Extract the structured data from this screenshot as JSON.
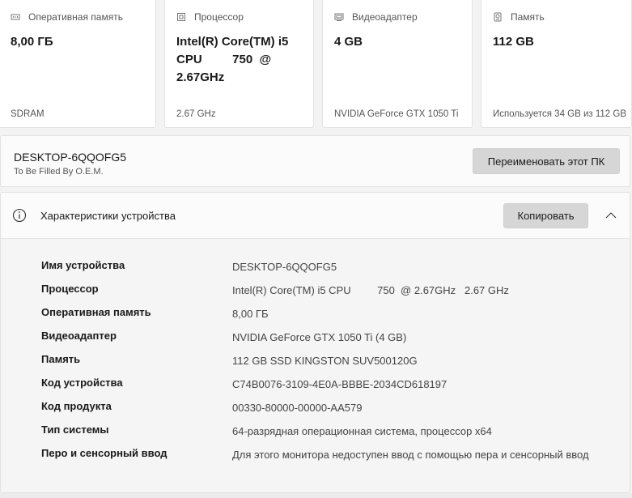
{
  "cards": [
    {
      "caption": "Оперативная память",
      "value": "8,00 ГБ",
      "sub": "SDRAM",
      "icon": "ram-icon"
    },
    {
      "caption": "Процессор",
      "value": "Intel(R) Core(TM) i5\nCPU         750  @\n2.67GHz",
      "sub": "2.67 GHz",
      "icon": "cpu-icon"
    },
    {
      "caption": "Видеоадаптер",
      "value": "4 GB",
      "sub": "NVIDIA GeForce GTX 1050 Ti",
      "icon": "gpu-icon"
    },
    {
      "caption": "Память",
      "value": "112 GB",
      "sub": "Используется 34 GB из 112 GB",
      "icon": "storage-icon"
    }
  ],
  "device": {
    "name": "DESKTOP-6QQOFG5",
    "oem": "To Be Filled By O.E.M.",
    "rename_label": "Переименовать этот ПК"
  },
  "specs": {
    "title": "Характеристики устройства",
    "copy_label": "Копировать",
    "rows": [
      {
        "key": "Имя устройства",
        "value": "DESKTOP-6QQOFG5"
      },
      {
        "key": "Процессор",
        "value": "Intel(R) Core(TM) i5 CPU         750  @ 2.67GHz   2.67 GHz"
      },
      {
        "key": "Оперативная память",
        "value": "8,00 ГБ"
      },
      {
        "key": "Видеоадаптер",
        "value": "NVIDIA GeForce GTX 1050 Ti (4 GB)"
      },
      {
        "key": "Память",
        "value": "112 GB SSD KINGSTON SUV500120G"
      },
      {
        "key": "Код устройства",
        "value": "C74B0076-3109-4E0A-BBBE-2034CD618197"
      },
      {
        "key": "Код продукта",
        "value": "00330-80000-00000-AA579"
      },
      {
        "key": "Тип системы",
        "value": "64-разрядная операционная система, процессор x64"
      },
      {
        "key": "Перо и сенсорный ввод",
        "value": "Для этого монитора недоступен ввод с помощью пера и сенсорный ввод"
      }
    ]
  }
}
